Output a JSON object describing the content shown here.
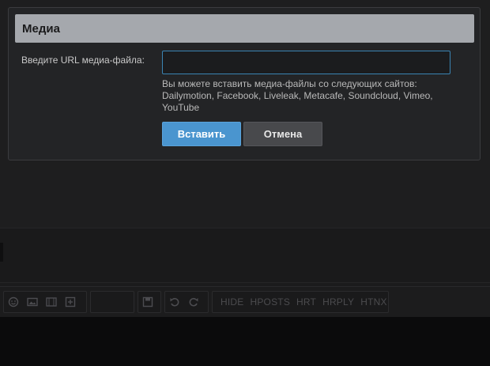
{
  "dialog": {
    "title": "Медиа",
    "url_label": "Введите URL медиа-файла:",
    "url_value": "",
    "hint_line1": "Вы можете вставить медиа-файлы со следующих сайтов:",
    "hint_line2": "Dailymotion, Facebook, Liveleak, Metacafe, Soundcloud, Vimeo,",
    "hint_line3": "YouTube",
    "insert_label": "Вставить",
    "cancel_label": "Отмена"
  },
  "toolbar": {
    "icons": [
      "smiley-icon",
      "image-icon",
      "film-icon",
      "plus-box-icon",
      "save-icon",
      "undo-icon",
      "redo-icon"
    ],
    "tags": [
      "HIDE",
      "HPOSTS",
      "HRT",
      "HRPLY",
      "HTNX"
    ]
  },
  "colors": {
    "accent": "#4a95cf",
    "header_bg": "#a5a8ad",
    "dialog_bg": "#232426",
    "input_border": "#3a84b3"
  }
}
